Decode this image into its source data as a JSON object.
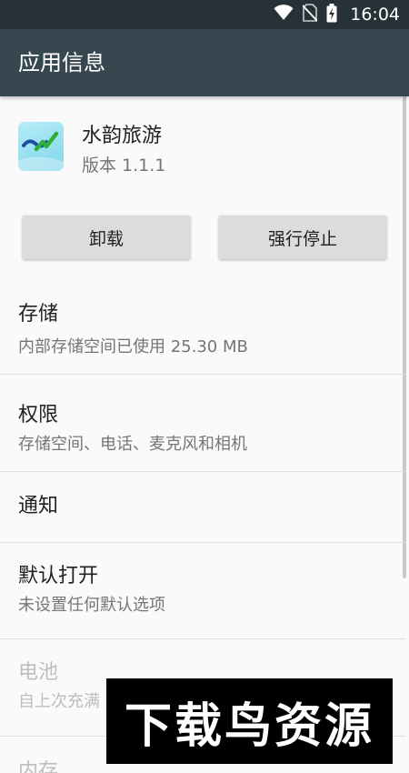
{
  "status_bar": {
    "time": "16:04",
    "icons": [
      "wifi-icon",
      "no-sim-icon",
      "battery-charging-icon"
    ]
  },
  "app_bar": {
    "title": "应用信息"
  },
  "app": {
    "name": "水韵旅游",
    "version": "版本 1.1.1",
    "icon": "app-icon"
  },
  "buttons": {
    "uninstall": "卸载",
    "force_stop": "强行停止"
  },
  "prefs": [
    {
      "title": "存储",
      "summary": "内部存储空间已使用 25.30 MB",
      "enabled": true
    },
    {
      "title": "权限",
      "summary": "存储空间、电话、麦克风和相机",
      "enabled": true
    },
    {
      "title": "通知",
      "summary": "",
      "enabled": true
    },
    {
      "title": "默认打开",
      "summary": "未设置任何默认选项",
      "enabled": true
    },
    {
      "title": "电池",
      "summary": "自上次充满",
      "enabled": false
    },
    {
      "title": "内存",
      "summary": "",
      "enabled": false
    }
  ],
  "watermark": {
    "text": "下载鸟资源"
  },
  "colors": {
    "status_bar": "#263238",
    "app_bar": "#37474f",
    "background": "#fafafa",
    "button": "#dcdcdc",
    "primary_text": "#212121",
    "secondary_text": "#757575",
    "disabled_text": "#bdbdbd"
  }
}
